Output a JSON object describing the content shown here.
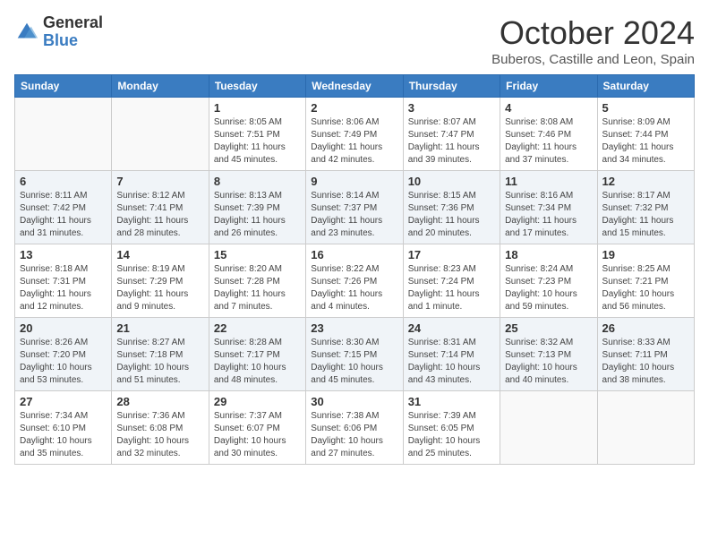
{
  "header": {
    "logo_general": "General",
    "logo_blue": "Blue",
    "month_title": "October 2024",
    "subtitle": "Buberos, Castille and Leon, Spain"
  },
  "days_of_week": [
    "Sunday",
    "Monday",
    "Tuesday",
    "Wednesday",
    "Thursday",
    "Friday",
    "Saturday"
  ],
  "weeks": [
    {
      "shaded": false,
      "days": [
        {
          "num": "",
          "sunrise": "",
          "sunset": "",
          "daylight": ""
        },
        {
          "num": "",
          "sunrise": "",
          "sunset": "",
          "daylight": ""
        },
        {
          "num": "1",
          "sunrise": "Sunrise: 8:05 AM",
          "sunset": "Sunset: 7:51 PM",
          "daylight": "Daylight: 11 hours and 45 minutes."
        },
        {
          "num": "2",
          "sunrise": "Sunrise: 8:06 AM",
          "sunset": "Sunset: 7:49 PM",
          "daylight": "Daylight: 11 hours and 42 minutes."
        },
        {
          "num": "3",
          "sunrise": "Sunrise: 8:07 AM",
          "sunset": "Sunset: 7:47 PM",
          "daylight": "Daylight: 11 hours and 39 minutes."
        },
        {
          "num": "4",
          "sunrise": "Sunrise: 8:08 AM",
          "sunset": "Sunset: 7:46 PM",
          "daylight": "Daylight: 11 hours and 37 minutes."
        },
        {
          "num": "5",
          "sunrise": "Sunrise: 8:09 AM",
          "sunset": "Sunset: 7:44 PM",
          "daylight": "Daylight: 11 hours and 34 minutes."
        }
      ]
    },
    {
      "shaded": true,
      "days": [
        {
          "num": "6",
          "sunrise": "Sunrise: 8:11 AM",
          "sunset": "Sunset: 7:42 PM",
          "daylight": "Daylight: 11 hours and 31 minutes."
        },
        {
          "num": "7",
          "sunrise": "Sunrise: 8:12 AM",
          "sunset": "Sunset: 7:41 PM",
          "daylight": "Daylight: 11 hours and 28 minutes."
        },
        {
          "num": "8",
          "sunrise": "Sunrise: 8:13 AM",
          "sunset": "Sunset: 7:39 PM",
          "daylight": "Daylight: 11 hours and 26 minutes."
        },
        {
          "num": "9",
          "sunrise": "Sunrise: 8:14 AM",
          "sunset": "Sunset: 7:37 PM",
          "daylight": "Daylight: 11 hours and 23 minutes."
        },
        {
          "num": "10",
          "sunrise": "Sunrise: 8:15 AM",
          "sunset": "Sunset: 7:36 PM",
          "daylight": "Daylight: 11 hours and 20 minutes."
        },
        {
          "num": "11",
          "sunrise": "Sunrise: 8:16 AM",
          "sunset": "Sunset: 7:34 PM",
          "daylight": "Daylight: 11 hours and 17 minutes."
        },
        {
          "num": "12",
          "sunrise": "Sunrise: 8:17 AM",
          "sunset": "Sunset: 7:32 PM",
          "daylight": "Daylight: 11 hours and 15 minutes."
        }
      ]
    },
    {
      "shaded": false,
      "days": [
        {
          "num": "13",
          "sunrise": "Sunrise: 8:18 AM",
          "sunset": "Sunset: 7:31 PM",
          "daylight": "Daylight: 11 hours and 12 minutes."
        },
        {
          "num": "14",
          "sunrise": "Sunrise: 8:19 AM",
          "sunset": "Sunset: 7:29 PM",
          "daylight": "Daylight: 11 hours and 9 minutes."
        },
        {
          "num": "15",
          "sunrise": "Sunrise: 8:20 AM",
          "sunset": "Sunset: 7:28 PM",
          "daylight": "Daylight: 11 hours and 7 minutes."
        },
        {
          "num": "16",
          "sunrise": "Sunrise: 8:22 AM",
          "sunset": "Sunset: 7:26 PM",
          "daylight": "Daylight: 11 hours and 4 minutes."
        },
        {
          "num": "17",
          "sunrise": "Sunrise: 8:23 AM",
          "sunset": "Sunset: 7:24 PM",
          "daylight": "Daylight: 11 hours and 1 minute."
        },
        {
          "num": "18",
          "sunrise": "Sunrise: 8:24 AM",
          "sunset": "Sunset: 7:23 PM",
          "daylight": "Daylight: 10 hours and 59 minutes."
        },
        {
          "num": "19",
          "sunrise": "Sunrise: 8:25 AM",
          "sunset": "Sunset: 7:21 PM",
          "daylight": "Daylight: 10 hours and 56 minutes."
        }
      ]
    },
    {
      "shaded": true,
      "days": [
        {
          "num": "20",
          "sunrise": "Sunrise: 8:26 AM",
          "sunset": "Sunset: 7:20 PM",
          "daylight": "Daylight: 10 hours and 53 minutes."
        },
        {
          "num": "21",
          "sunrise": "Sunrise: 8:27 AM",
          "sunset": "Sunset: 7:18 PM",
          "daylight": "Daylight: 10 hours and 51 minutes."
        },
        {
          "num": "22",
          "sunrise": "Sunrise: 8:28 AM",
          "sunset": "Sunset: 7:17 PM",
          "daylight": "Daylight: 10 hours and 48 minutes."
        },
        {
          "num": "23",
          "sunrise": "Sunrise: 8:30 AM",
          "sunset": "Sunset: 7:15 PM",
          "daylight": "Daylight: 10 hours and 45 minutes."
        },
        {
          "num": "24",
          "sunrise": "Sunrise: 8:31 AM",
          "sunset": "Sunset: 7:14 PM",
          "daylight": "Daylight: 10 hours and 43 minutes."
        },
        {
          "num": "25",
          "sunrise": "Sunrise: 8:32 AM",
          "sunset": "Sunset: 7:13 PM",
          "daylight": "Daylight: 10 hours and 40 minutes."
        },
        {
          "num": "26",
          "sunrise": "Sunrise: 8:33 AM",
          "sunset": "Sunset: 7:11 PM",
          "daylight": "Daylight: 10 hours and 38 minutes."
        }
      ]
    },
    {
      "shaded": false,
      "days": [
        {
          "num": "27",
          "sunrise": "Sunrise: 7:34 AM",
          "sunset": "Sunset: 6:10 PM",
          "daylight": "Daylight: 10 hours and 35 minutes."
        },
        {
          "num": "28",
          "sunrise": "Sunrise: 7:36 AM",
          "sunset": "Sunset: 6:08 PM",
          "daylight": "Daylight: 10 hours and 32 minutes."
        },
        {
          "num": "29",
          "sunrise": "Sunrise: 7:37 AM",
          "sunset": "Sunset: 6:07 PM",
          "daylight": "Daylight: 10 hours and 30 minutes."
        },
        {
          "num": "30",
          "sunrise": "Sunrise: 7:38 AM",
          "sunset": "Sunset: 6:06 PM",
          "daylight": "Daylight: 10 hours and 27 minutes."
        },
        {
          "num": "31",
          "sunrise": "Sunrise: 7:39 AM",
          "sunset": "Sunset: 6:05 PM",
          "daylight": "Daylight: 10 hours and 25 minutes."
        },
        {
          "num": "",
          "sunrise": "",
          "sunset": "",
          "daylight": ""
        },
        {
          "num": "",
          "sunrise": "",
          "sunset": "",
          "daylight": ""
        }
      ]
    }
  ]
}
